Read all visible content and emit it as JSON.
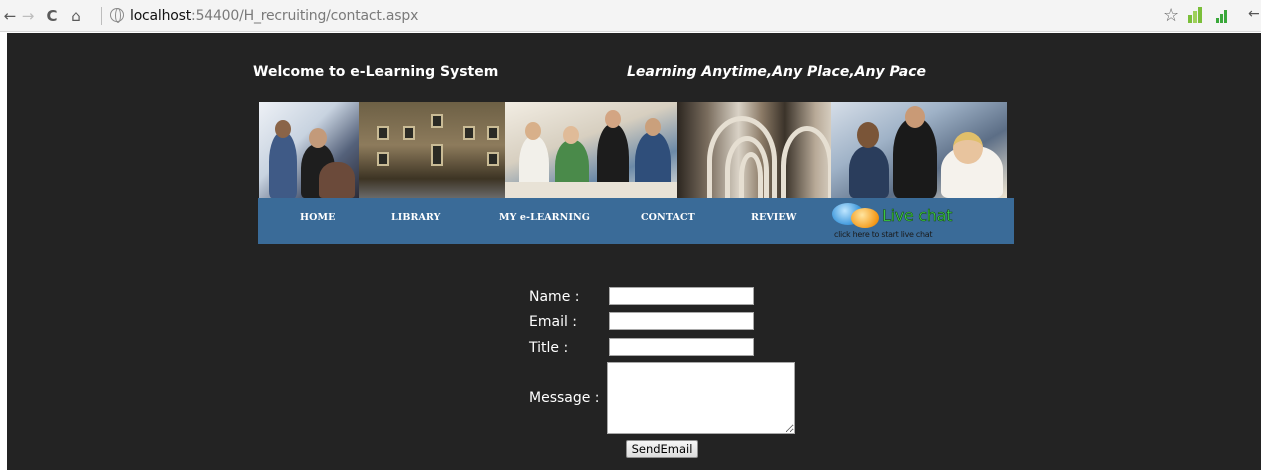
{
  "browser": {
    "url_host": "localhost",
    "url_path": ":54400/H_recruiting/contact.aspx",
    "icons": [
      "back-arrow-icon",
      "forward-arrow-icon",
      "reload-icon",
      "home-icon",
      "globe-icon",
      "star-icon",
      "extension-icon",
      "signal-icon"
    ]
  },
  "header": {
    "welcome": "Welcome to e-Learning System",
    "slogan": "Learning Anytime,Any Place,Any Pace"
  },
  "nav": {
    "items": [
      {
        "label": "HOME"
      },
      {
        "label": "LIBRARY"
      },
      {
        "label": "MY e-LEARNING"
      },
      {
        "label": "CONTACT"
      },
      {
        "label": "REVIEW"
      }
    ],
    "livechat_title": "Live chat",
    "livechat_sub": "click here to start live chat"
  },
  "form": {
    "name_label": "Name :",
    "email_label": "Email :",
    "title_label": "Title :",
    "message_label": "Message :",
    "name_value": "",
    "email_value": "",
    "title_value": "",
    "message_value": "",
    "submit_label": "SendEmail"
  },
  "colors": {
    "page_bg": "#232323",
    "nav_bg": "#3a6b98",
    "livechat_green": "#3fe04a"
  }
}
